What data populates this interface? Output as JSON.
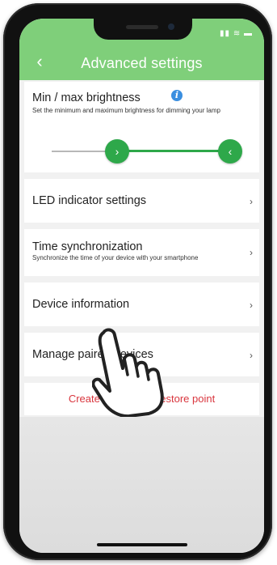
{
  "header": {
    "title": "Advanced settings",
    "back_icon": "chevron-left-icon"
  },
  "brightness": {
    "label": "Min / max brightness",
    "description": "Set the minimum and maximum brightness for dimming your lamp",
    "info_icon": "info-icon",
    "min_level": 0.27,
    "max_level": 0.94
  },
  "rows": {
    "led": {
      "label": "LED indicator settings"
    },
    "time": {
      "label": "Time synchronization",
      "description": "Synchronize the time of your device with your smartphone"
    },
    "device": {
      "label": "Device information"
    },
    "manage": {
      "label": "Manage paired devices"
    }
  },
  "restore": {
    "label": "Create an installer restore point"
  },
  "colors": {
    "header": "#7fcf7a",
    "accent": "#2ea84a",
    "danger": "#d9363e",
    "info": "#3b8fe0"
  }
}
